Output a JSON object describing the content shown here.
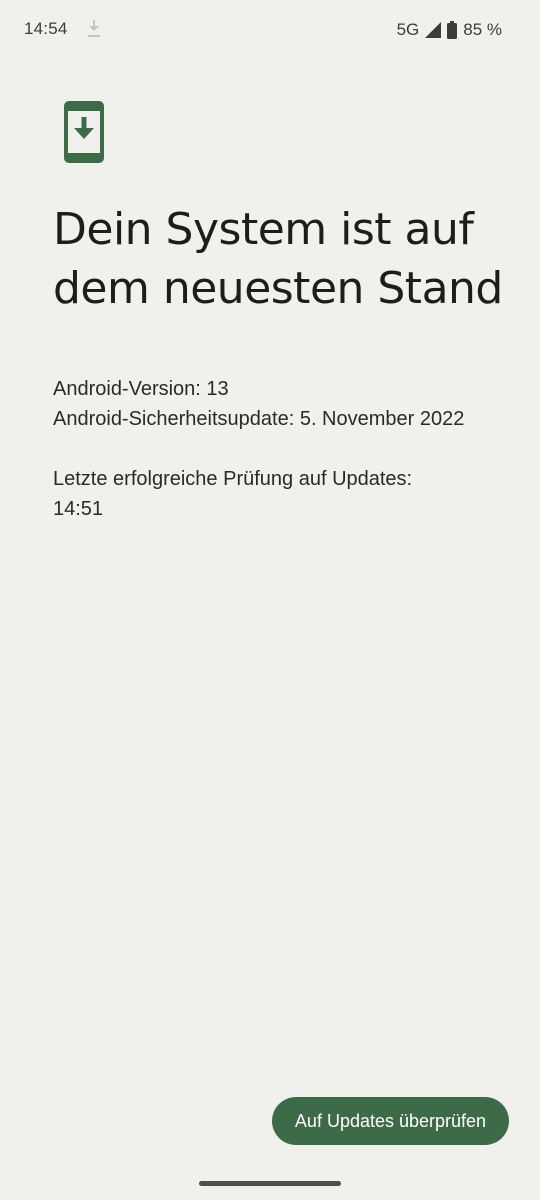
{
  "status_bar": {
    "time": "14:54",
    "network": "5G",
    "battery": "85 %",
    "icons": [
      "download-icon",
      "signal-icon",
      "battery-icon"
    ]
  },
  "page": {
    "icon": "system-update-icon",
    "title": "Dein System ist auf dem neuesten Stand",
    "android_version": "Android-Version: 13",
    "security_update": "Android-Sicherheitsupdate: 5. November 2022",
    "last_check_label": "Letzte erfolgreiche Prüfung auf Updates:",
    "last_check_time": "14:51"
  },
  "actions": {
    "check_updates_label": "Auf Updates überprüfen"
  },
  "colors": {
    "background": "#f0f0ec",
    "accent": "#3e6b47",
    "text": "#1d1d1b"
  }
}
